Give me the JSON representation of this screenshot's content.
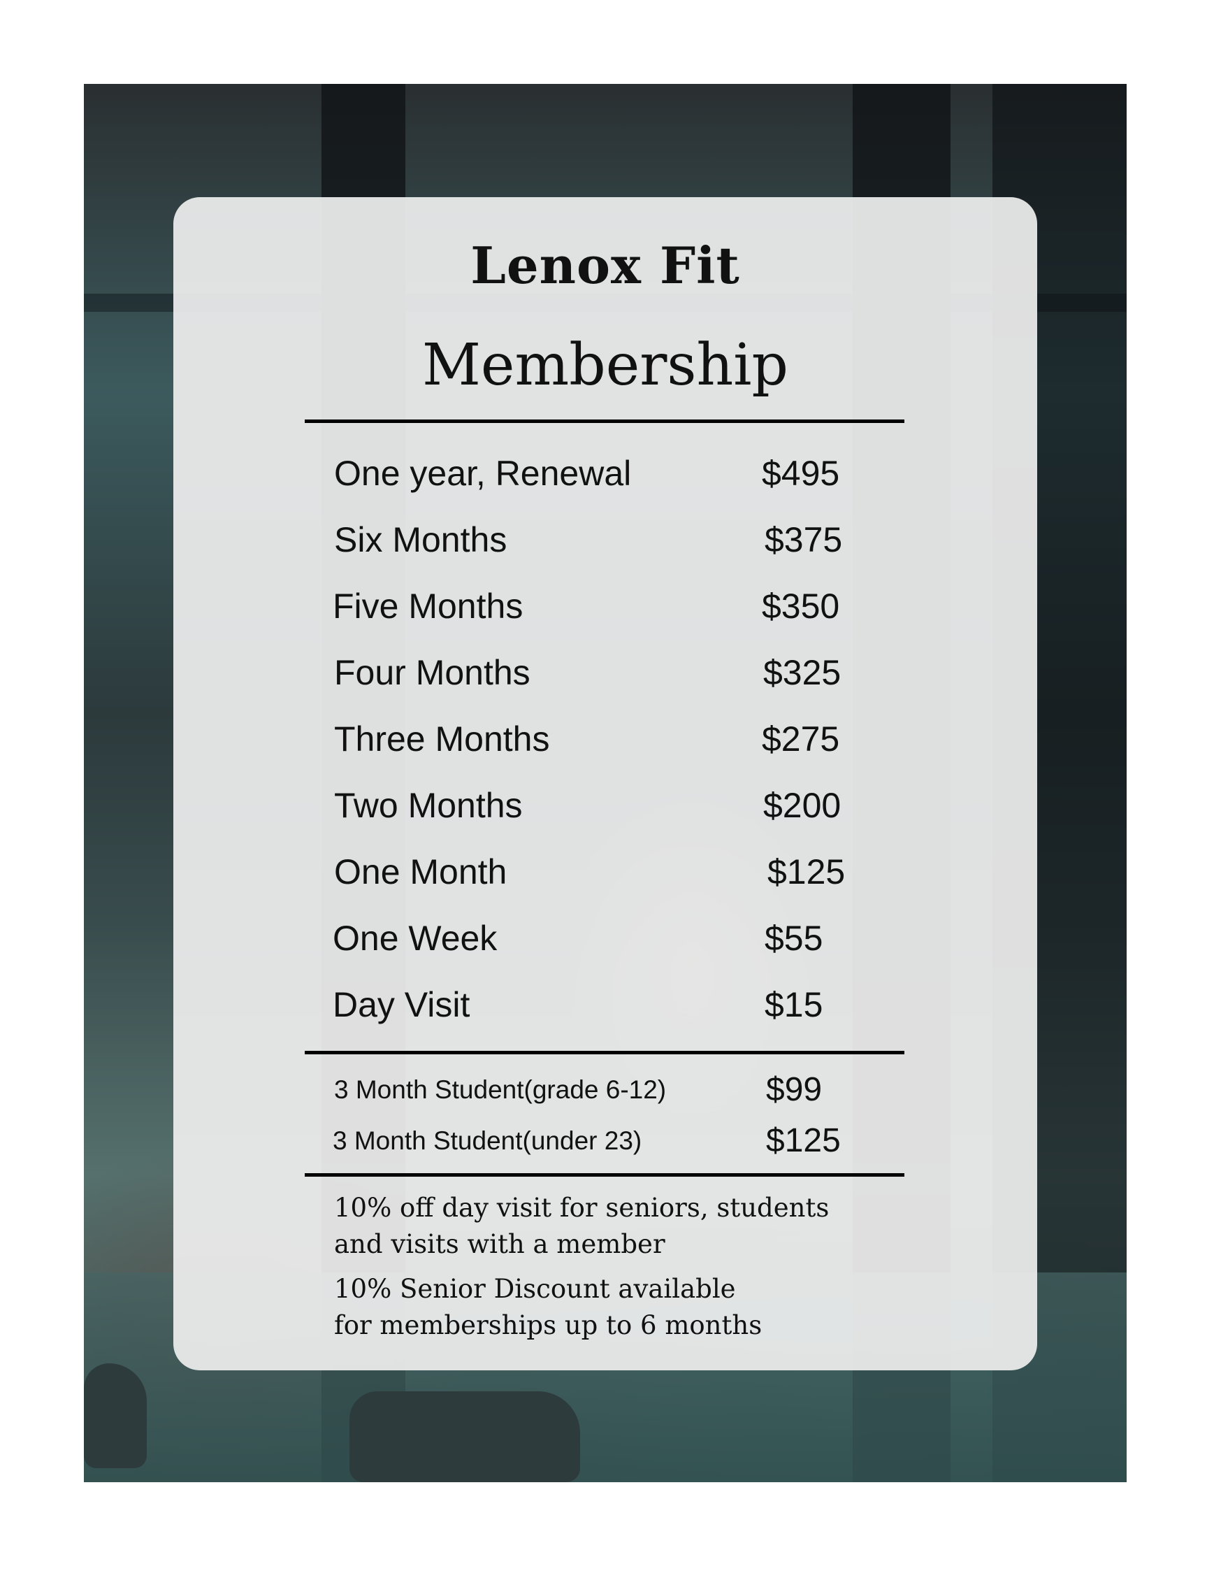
{
  "header": {
    "brand": "Lenox Fit",
    "title": "Membership"
  },
  "plans": [
    {
      "name": "One year, Renewal",
      "price": "$495"
    },
    {
      "name": "Six Months",
      "price": "$375"
    },
    {
      "name": "Five Months",
      "price": "$350"
    },
    {
      "name": "Four Months",
      "price": "$325"
    },
    {
      "name": "Three Months",
      "price": "$275"
    },
    {
      "name": "Two Months",
      "price": "$200"
    },
    {
      "name": "One Month",
      "price": "$125"
    },
    {
      "name": "One Week",
      "price": "$55"
    },
    {
      "name": "Day Visit",
      "price": "$15"
    }
  ],
  "student_plans": [
    {
      "name": "3 Month Student(grade 6-12)",
      "price": "$99"
    },
    {
      "name": "3 Month Student(under 23)",
      "price": "$125"
    }
  ],
  "notes": [
    "10% off day visit for seniors, students and visits with a member",
    "10% Senior Discount available for memberships up to 6 months"
  ]
}
